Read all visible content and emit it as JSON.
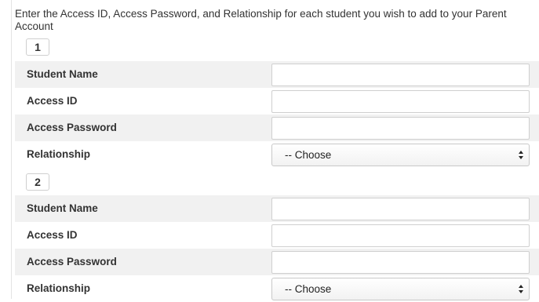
{
  "intro_text": "Enter the Access ID, Access Password, and Relationship for each student you wish to add to your Parent Account",
  "students": [
    {
      "number": "1",
      "student_name_label": "Student Name",
      "access_id_label": "Access ID",
      "access_password_label": "Access Password",
      "relationship_label": "Relationship",
      "relationship_value": "-- Choose"
    },
    {
      "number": "2",
      "student_name_label": "Student Name",
      "access_id_label": "Access ID",
      "access_password_label": "Access Password",
      "relationship_label": "Relationship",
      "relationship_value": "-- Choose"
    }
  ],
  "colors": {
    "row_shade": "#f1f1f1",
    "input_border": "#cfcfcf",
    "text": "#333333"
  },
  "icons": {
    "select_arrow": "chevron-up-down-icon"
  }
}
